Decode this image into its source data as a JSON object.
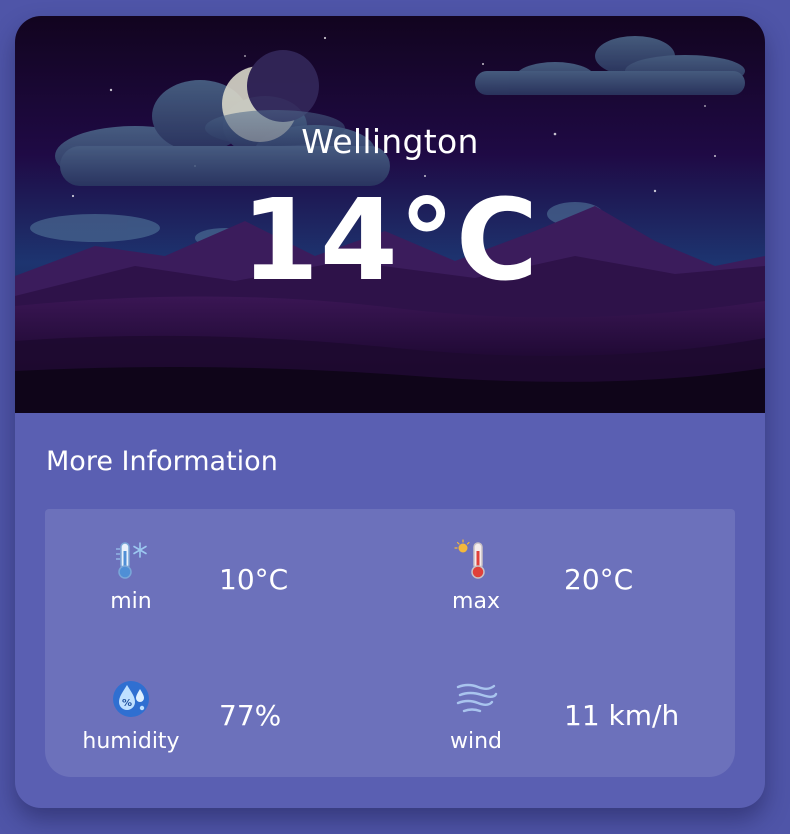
{
  "weather": {
    "city": "Wellington",
    "temperature": "14°C"
  },
  "more_info": {
    "title": "More Information",
    "items": [
      {
        "label": "min",
        "value": "10°C",
        "icon": "thermometer-cold-icon"
      },
      {
        "label": "max",
        "value": "20°C",
        "icon": "thermometer-hot-icon"
      },
      {
        "label": "humidity",
        "value": "77%",
        "icon": "humidity-icon"
      },
      {
        "label": "wind",
        "value": "11 km/h",
        "icon": "wind-icon"
      }
    ]
  },
  "colors": {
    "page_background": "#4f55a8",
    "card_background": "#5a5fb2",
    "info_panel": "#6c71bb",
    "sky_top": "#14052a",
    "sky_bottom": "#1a3f7a",
    "text": "#ffffff"
  }
}
